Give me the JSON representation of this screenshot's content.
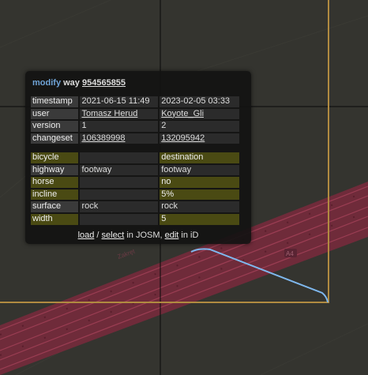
{
  "header": {
    "action": "modify",
    "type": "way",
    "id": "954565855"
  },
  "meta_rows": [
    {
      "key": "timestamp",
      "old": "2021-06-15 11:49",
      "new": "2023-02-05 03:33"
    },
    {
      "key": "user",
      "old": "Tomasz Herud",
      "new": "Koyote_Gli"
    },
    {
      "key": "version",
      "old": "1",
      "new": "2"
    },
    {
      "key": "changeset",
      "old": "106389998",
      "new": "132095942"
    }
  ],
  "tag_rows": [
    {
      "key": "bicycle",
      "old": "",
      "new": "destination",
      "changed": true
    },
    {
      "key": "highway",
      "old": "footway",
      "new": "footway",
      "changed": false
    },
    {
      "key": "horse",
      "old": "",
      "new": "no",
      "changed": true
    },
    {
      "key": "incline",
      "old": "",
      "new": "5%",
      "changed": true
    },
    {
      "key": "surface",
      "old": "rock",
      "new": "rock",
      "changed": false
    },
    {
      "key": "width",
      "old": "",
      "new": "5",
      "changed": true
    }
  ],
  "links": {
    "load": "load",
    "sep": " / ",
    "select": "select",
    "in_josm": " in JOSM, ",
    "edit": "edit",
    "in_id": " in iD"
  },
  "map": {
    "road_label": "Zakręt",
    "ref_badge": "A4"
  },
  "colors": {
    "action": "#6fa3d6",
    "highlight_row": "#4a4a13",
    "bbox_line": "#b08a40",
    "way_line": "#7fb8ee",
    "road": "#8a2f44"
  }
}
